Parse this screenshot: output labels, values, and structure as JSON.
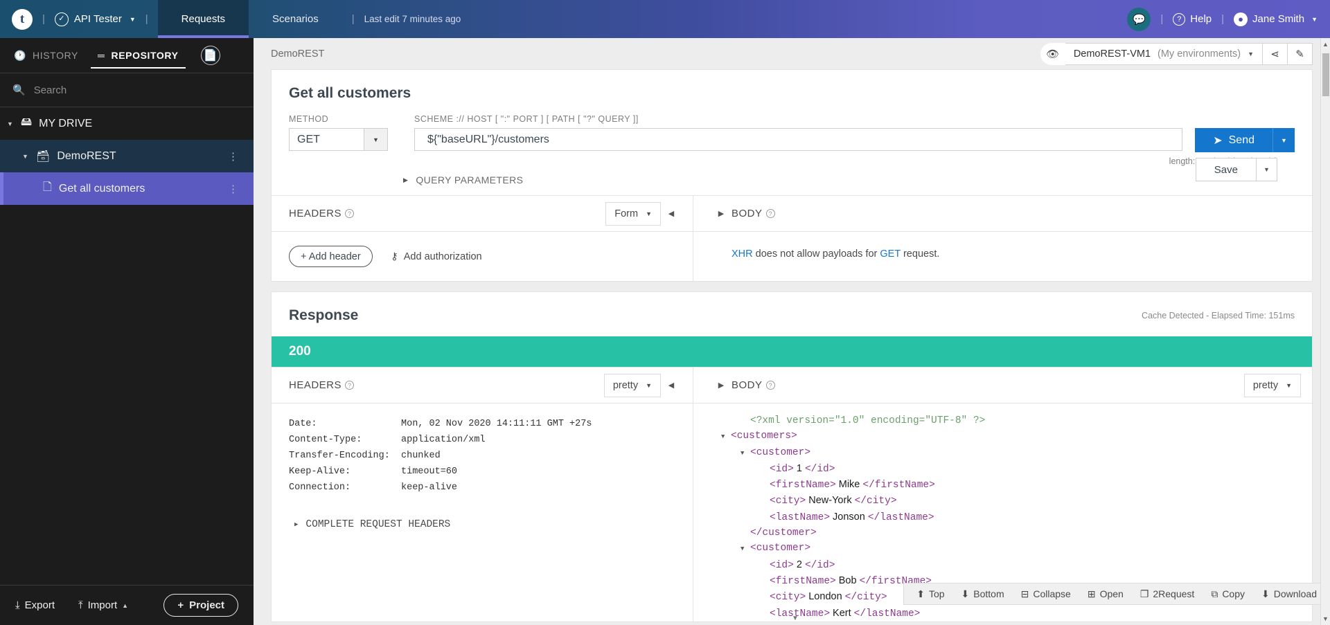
{
  "topbar": {
    "logo": "t",
    "app_name": "API Tester",
    "tabs": [
      {
        "label": "Requests",
        "active": true
      },
      {
        "label": "Scenarios",
        "active": false
      }
    ],
    "last_edit": "Last edit 7 minutes ago",
    "help_label": "Help",
    "user_name": "Jane Smith",
    "chat_icon": "chat-icon",
    "divider": "|"
  },
  "sidebar": {
    "tabs": [
      {
        "label": "HISTORY",
        "icon": "history-icon",
        "active": false
      },
      {
        "label": "REPOSITORY",
        "icon": "database-icon",
        "active": true
      }
    ],
    "doc_icon": "document-icon",
    "search": {
      "placeholder": "Search",
      "value": "",
      "icon": "search-icon"
    },
    "tree": [
      {
        "label": "MY DRIVE",
        "level": 0,
        "icon": "drive-icon",
        "expanded": true,
        "selected": false
      },
      {
        "label": "DemoREST",
        "level": 1,
        "icon": "folder-icon",
        "expanded": true,
        "selected": false
      },
      {
        "label": "Get all customers",
        "level": 2,
        "icon": "request-file-icon",
        "expanded": false,
        "selected": true
      }
    ],
    "footer": {
      "export_label": "Export",
      "import_label": "Import",
      "project_label": "Project"
    }
  },
  "breadcrumb": "DemoREST",
  "environment": {
    "name": "DemoREST-VM1",
    "scope": "(My environments)",
    "eye_icon": "eye-icon",
    "share_icon": "share-icon",
    "edit_icon": "pencil-icon"
  },
  "request": {
    "title": "Get all customers",
    "save_label": "Save",
    "method_label": "METHOD",
    "method_value": "GET",
    "url_label": "SCHEME :// HOST [ \":\" PORT ] [ PATH [ \"?\" QUERY ]]",
    "url_value": "${\"baseURL\"}/customers",
    "send_label": "Send",
    "length_info": "length: 22 char(s) 30 byte(s)",
    "query_params_label": "QUERY PARAMETERS",
    "headers_label": "HEADERS",
    "headers_mode": "Form",
    "add_header_label": "Add header",
    "add_auth_label": "Add authorization",
    "body_label": "BODY",
    "body_note_prefix": "XHR",
    "body_note_mid": " does not allow payloads for ",
    "body_note_method": "GET",
    "body_note_suffix": " request."
  },
  "response": {
    "title": "Response",
    "meta": "Cache Detected - Elapsed Time: 151ms",
    "status_code": "200",
    "headers_label": "HEADERS",
    "headers_mode": "pretty",
    "body_label": "BODY",
    "body_mode": "pretty",
    "headers": [
      {
        "key": "Date:",
        "value": "Mon, 02 Nov 2020 14:11:11 GMT +27s"
      },
      {
        "key": "Content-Type:",
        "value": "application/xml"
      },
      {
        "key": "Transfer-Encoding:",
        "value": "chunked"
      },
      {
        "key": "Keep-Alive:",
        "value": "timeout=60"
      },
      {
        "key": "Connection:",
        "value": "keep-alive"
      }
    ],
    "complete_headers_label": "COMPLETE REQUEST HEADERS",
    "body_lines": [
      {
        "indent": 1,
        "fold": "",
        "type": "decl",
        "text": "<?xml version=\"1.0\" encoding=\"UTF-8\" ?>"
      },
      {
        "indent": 0,
        "fold": "▼",
        "type": "tag",
        "text": "<customers>"
      },
      {
        "indent": 1,
        "fold": "▼",
        "type": "tag",
        "text": "<customer>"
      },
      {
        "indent": 2,
        "fold": "",
        "type": "pair",
        "open": "<id>",
        "value": " 1 ",
        "close": "</id>"
      },
      {
        "indent": 2,
        "fold": "",
        "type": "pair",
        "open": "<firstName>",
        "value": " Mike ",
        "close": "</firstName>"
      },
      {
        "indent": 2,
        "fold": "",
        "type": "pair",
        "open": "<city>",
        "value": " New-York ",
        "close": "</city>"
      },
      {
        "indent": 2,
        "fold": "",
        "type": "pair",
        "open": "<lastName>",
        "value": " Jonson ",
        "close": "</lastName>"
      },
      {
        "indent": 1,
        "fold": "",
        "type": "tag",
        "text": "</customer>"
      },
      {
        "indent": 1,
        "fold": "▼",
        "type": "tag",
        "text": "<customer>"
      },
      {
        "indent": 2,
        "fold": "",
        "type": "pair",
        "open": "<id>",
        "value": " 2 ",
        "close": "</id>"
      },
      {
        "indent": 2,
        "fold": "",
        "type": "pair",
        "open": "<firstName>",
        "value": " Bob ",
        "close": "</firstName>"
      },
      {
        "indent": 2,
        "fold": "",
        "type": "pair",
        "open": "<city>",
        "value": " London ",
        "close": "</city>"
      },
      {
        "indent": 2,
        "fold": "",
        "type": "pair",
        "open": "<lastName>",
        "value": " Kert ",
        "close": "</lastName>"
      }
    ],
    "tools": [
      {
        "label": "Top",
        "icon": "arrow-up-circle-icon"
      },
      {
        "label": "Bottom",
        "icon": "arrow-down-circle-icon"
      },
      {
        "label": "Collapse",
        "icon": "minus-square-icon"
      },
      {
        "label": "Open",
        "icon": "plus-square-icon"
      },
      {
        "label": "2Request",
        "icon": "file-copy-icon"
      },
      {
        "label": "Copy",
        "icon": "copy-icon"
      },
      {
        "label": "Download",
        "icon": "download-icon"
      }
    ]
  },
  "colors": {
    "accent_blue": "#1476cd",
    "status_green": "#27c2a5",
    "purple": "#5a5ac0",
    "topbar_dark": "#1b4f6e"
  }
}
